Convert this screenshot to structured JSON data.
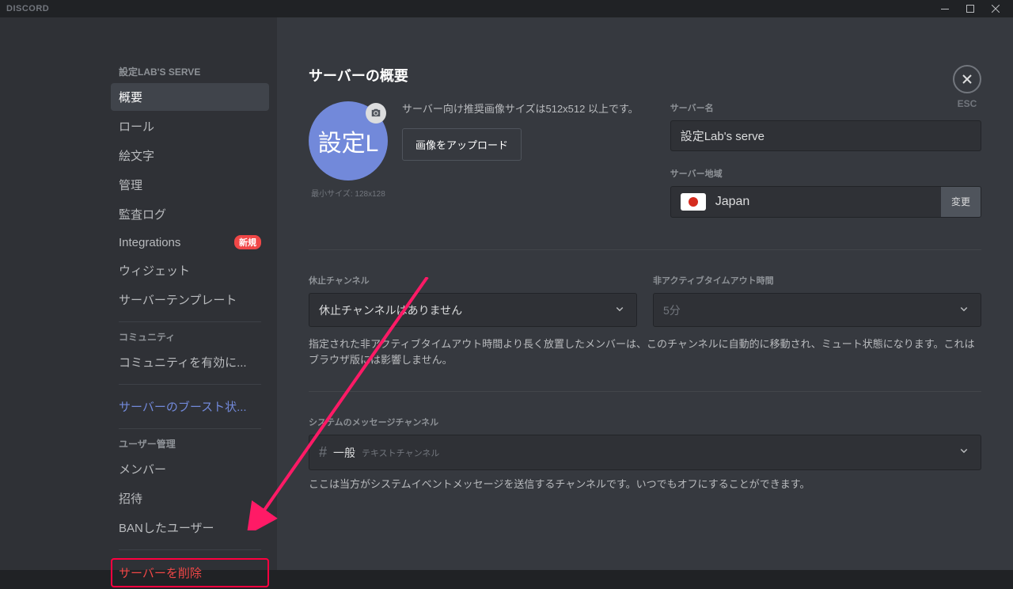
{
  "titlebar": {
    "brand": "DISCORD"
  },
  "sidebar": {
    "header": "設定LAB'S SERVE",
    "items": {
      "overview": "概要",
      "roles": "ロール",
      "emoji": "絵文字",
      "moderation": "管理",
      "auditlog": "監査ログ",
      "integrations": "Integrations",
      "widget": "ウィジェット",
      "template": "サーバーテンプレート"
    },
    "integrations_badge": "新規",
    "cat_community": "コミュニティ",
    "community_enable": "コミュニティを有効に...",
    "boost": "サーバーのブースト状...",
    "cat_users": "ユーザー管理",
    "members": "メンバー",
    "invites": "招待",
    "bans": "BANしたユーザー",
    "delete": "サーバーを削除"
  },
  "close": {
    "label": "ESC"
  },
  "main": {
    "title": "サーバーの概要",
    "avatar_text": "設定L",
    "avatar_hint": "最小サイズ: 128x128",
    "upload_desc": "サーバー向け推奨画像サイズは512x512 以上です。",
    "upload_btn": "画像をアップロード",
    "name_label": "サーバー名",
    "name_value": "設定Lab's serve",
    "region_label": "サーバー地域",
    "region_value": "Japan",
    "region_change": "変更",
    "afk_channel_label": "休止チャンネル",
    "afk_channel_value": "休止チャンネルはありません",
    "afk_timeout_label": "非アクティブタイムアウト時間",
    "afk_timeout_value": "5分",
    "afk_help": "指定された非アクティブタイムアウト時間より長く放置したメンバーは、このチャンネルに自動的に移動され、ミュート状態になります。これはブラウザ版には影響しません。",
    "sys_label": "システムのメッセージチャンネル",
    "sys_channel": "一般",
    "sys_category": "テキストチャンネル",
    "sys_help": "ここは当方がシステムイベントメッセージを送信するチャンネルです。いつでもオフにすることができます。"
  }
}
